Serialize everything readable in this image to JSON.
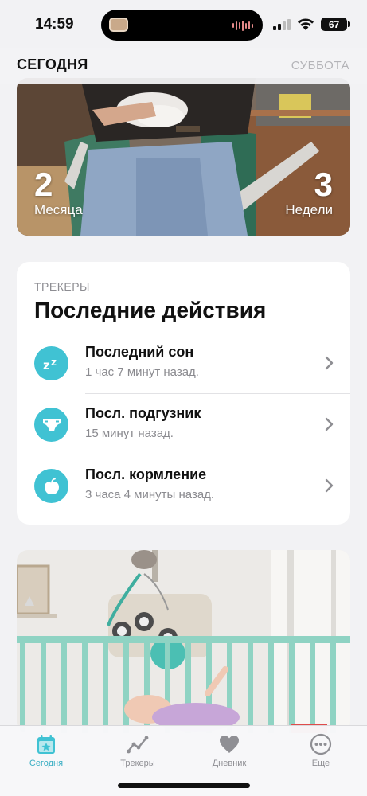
{
  "status_bar": {
    "time": "14:59",
    "battery": "67"
  },
  "header": {
    "title": "СЕГОДНЯ",
    "day": "СУББОТА"
  },
  "hero": {
    "left_number": "2",
    "left_unit": "Месяца",
    "right_number": "3",
    "right_unit": "Недели"
  },
  "trackers": {
    "label": "ТРЕКЕРЫ",
    "title": "Последние действия",
    "items": [
      {
        "title": "Последний сон",
        "subtitle": "1 час 7 минут назад.",
        "icon": "sleep-zz-icon"
      },
      {
        "title": "Посл. подгузник",
        "subtitle": "15 минут назад.",
        "icon": "diaper-icon"
      },
      {
        "title": "Посл. кормление",
        "subtitle": "3 часа 4 минуты назад.",
        "icon": "apple-icon"
      }
    ]
  },
  "tabs": [
    {
      "label": "Сегодня",
      "icon": "calendar-star-icon",
      "active": true
    },
    {
      "label": "Трекеры",
      "icon": "trend-line-icon",
      "active": false
    },
    {
      "label": "Дневник",
      "icon": "heart-icon",
      "active": false
    },
    {
      "label": "Еще",
      "icon": "more-dots-icon",
      "active": false
    }
  ],
  "colors": {
    "accent": "#40c2d3",
    "tab_active": "#3aaec3",
    "background": "#f2f2f4"
  }
}
